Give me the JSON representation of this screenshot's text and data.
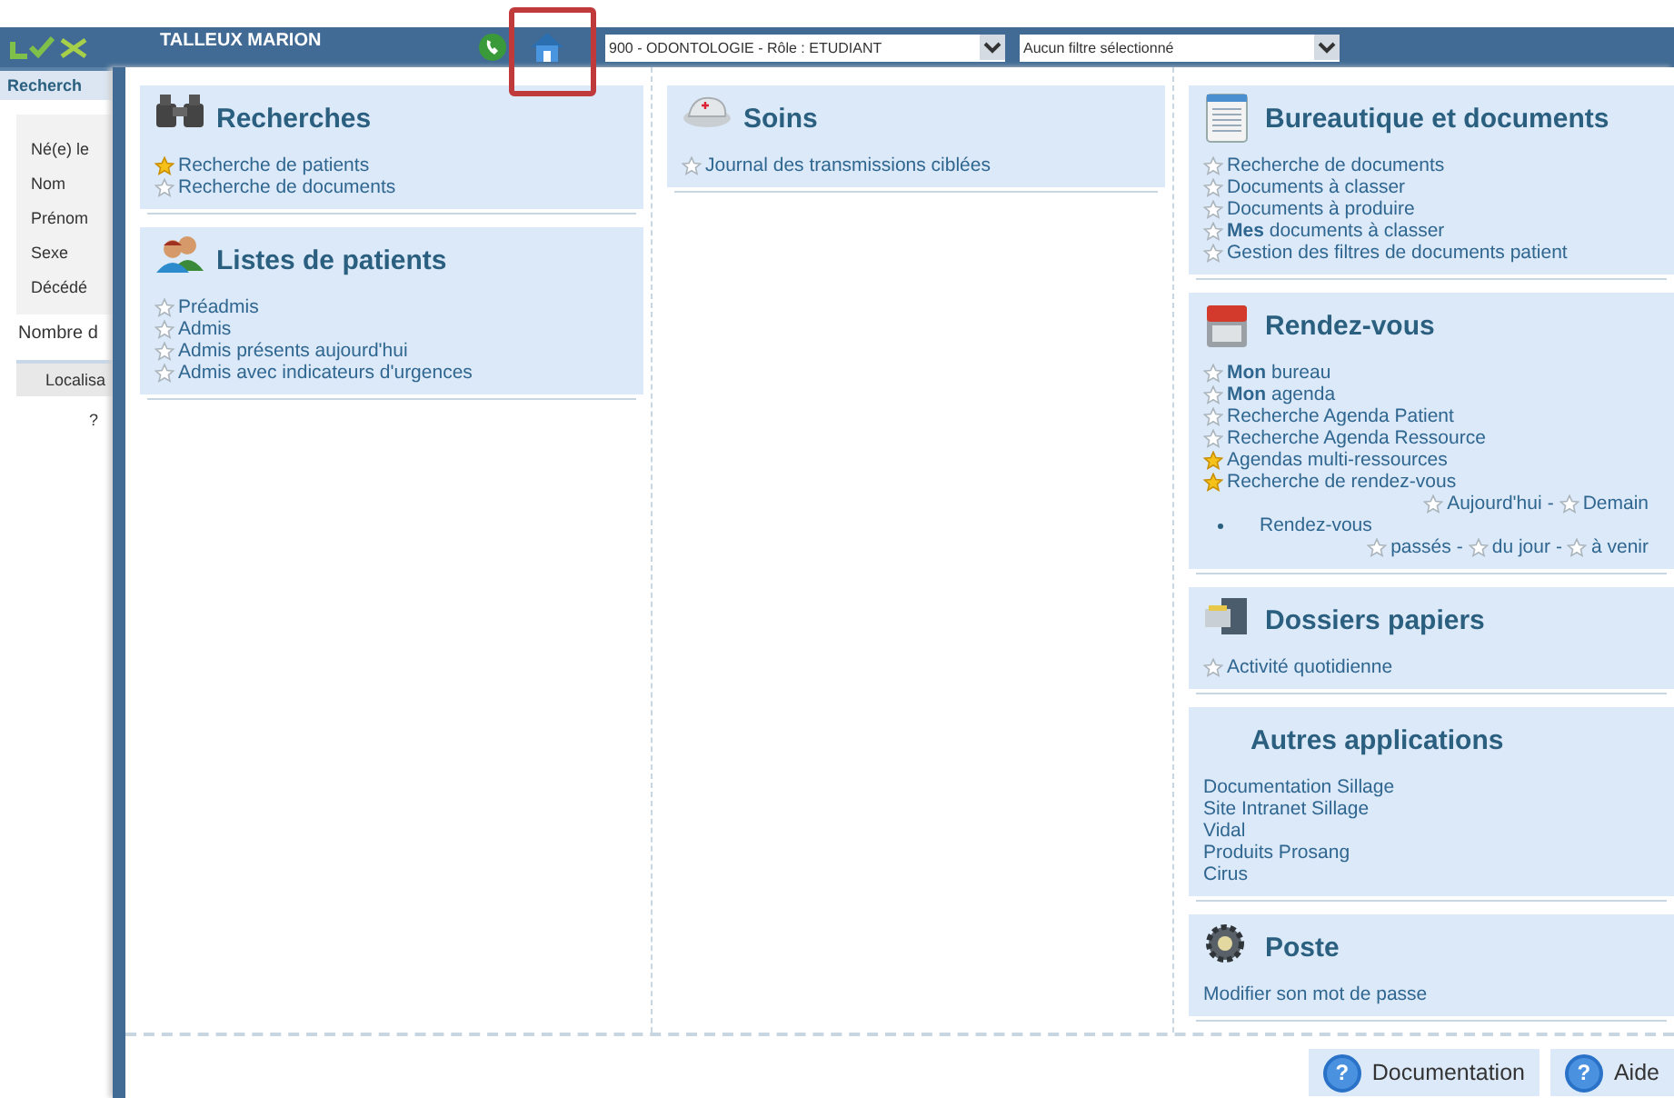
{
  "header": {
    "user": "TALLEUX MARION",
    "role_select": "900 - ODONTOLOGIE - Rôle : ETUDIANT",
    "filter_select": "Aucun filtre sélectionné"
  },
  "background_page": {
    "tab": "Recherch",
    "field_labels": [
      "Né(e) le",
      "Nom",
      "Prénom",
      "Sexe",
      "Décédé"
    ],
    "count_label": "Nombre d",
    "column_1": "Localisa",
    "cell": "?"
  },
  "menu": {
    "columns": [
      {
        "sections": [
          {
            "kind": "binoculars",
            "title": "Recherches",
            "items": [
              {
                "kind": "link",
                "text": "Recherche de patients",
                "favorite": true
              },
              {
                "kind": "link",
                "text": "Recherche de documents",
                "favorite": false
              }
            ]
          },
          {
            "kind": "people",
            "title": "Listes de patients",
            "items": [
              {
                "kind": "link",
                "text": "Préadmis",
                "favorite": false
              },
              {
                "kind": "link",
                "text": "Admis",
                "favorite": false
              },
              {
                "kind": "link",
                "text": "Admis présents aujourd'hui",
                "favorite": false
              },
              {
                "kind": "link",
                "text": "Admis avec indicateurs d'urgences",
                "favorite": false
              }
            ]
          }
        ]
      },
      {
        "sections": [
          {
            "kind": "cap",
            "title": "Soins",
            "items": [
              {
                "kind": "link",
                "text": "Journal des transmissions ciblées",
                "favorite": false
              }
            ]
          }
        ]
      },
      {
        "sections": [
          {
            "kind": "document",
            "title": "Bureautique et documents",
            "items": [
              {
                "kind": "link",
                "text": "Recherche de documents",
                "favorite": false
              },
              {
                "kind": "link",
                "text": "Documents à classer",
                "favorite": false
              },
              {
                "kind": "link",
                "text": "Documents à produire",
                "favorite": false
              },
              {
                "kind": "link",
                "text": "**Mes** documents à classer",
                "favorite": false
              },
              {
                "kind": "link",
                "text": "Gestion des filtres de documents patient",
                "favorite": false
              }
            ]
          },
          {
            "kind": "calendar",
            "title": "Rendez-vous",
            "items": [
              {
                "kind": "link",
                "text": "**Mon** bureau",
                "favorite": false
              },
              {
                "kind": "link",
                "text": "**Mon** agenda",
                "favorite": false
              },
              {
                "kind": "link",
                "text": "Recherche Agenda Patient",
                "favorite": false
              },
              {
                "kind": "link",
                "text": "Recherche Agenda Ressource",
                "favorite": false
              },
              {
                "kind": "link",
                "text": "Agendas multi-ressources",
                "favorite": true
              },
              {
                "kind": "link",
                "text": "Recherche de rendez-vous",
                "favorite": true
              },
              {
                "kind": "sublinks",
                "separator": "-",
                "links": [
                  {
                    "text": "Aujourd'hui",
                    "favorite": false
                  },
                  {
                    "text": "Demain",
                    "favorite": false
                  }
                ]
              },
              {
                "kind": "bullet",
                "text": "Rendez-vous"
              },
              {
                "kind": "sublinks",
                "separator": "-",
                "links": [
                  {
                    "text": "passés",
                    "favorite": false
                  },
                  {
                    "text": "du jour",
                    "favorite": false
                  },
                  {
                    "text": "à venir",
                    "favorite": false
                  }
                ]
              }
            ]
          },
          {
            "kind": "drawer",
            "title": "Dossiers papiers",
            "items": [
              {
                "kind": "link",
                "text": "Activité quotidienne",
                "favorite": false
              }
            ]
          },
          {
            "kind": "plain",
            "title": "Autres applications",
            "items": [
              {
                "kind": "plain",
                "text": "Documentation Sillage"
              },
              {
                "kind": "plain",
                "text": "Site Intranet Sillage"
              },
              {
                "kind": "plain",
                "text": "Vidal"
              },
              {
                "kind": "plain",
                "text": "Produits Prosang"
              },
              {
                "kind": "plain",
                "text": "Cirus"
              }
            ]
          },
          {
            "kind": "gear",
            "title": "Poste",
            "items": [
              {
                "kind": "plain",
                "text": "Modifier son mot de passe"
              }
            ]
          }
        ]
      }
    ],
    "footer_buttons": [
      {
        "symbol": "?",
        "label": "Documentation"
      },
      {
        "symbol": "?",
        "label": "Aide"
      }
    ]
  }
}
